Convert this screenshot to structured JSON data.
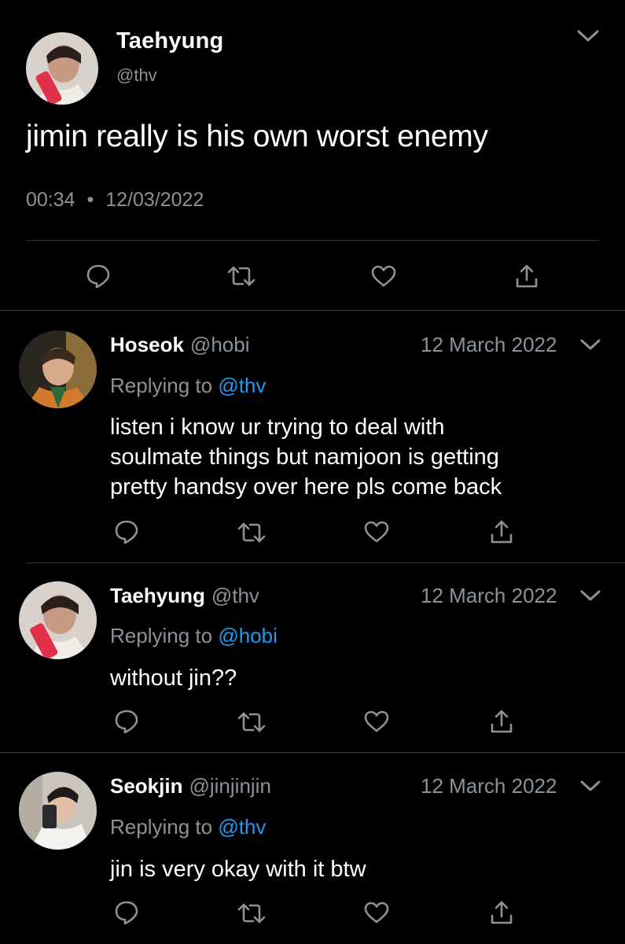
{
  "main_tweet": {
    "name": "Taehyung",
    "handle": "@thv",
    "text": "jimin really is his own worst enemy",
    "time": "00:34",
    "separator": "•",
    "date": "12/03/2022",
    "avatar_icon": "avatar-taehyung",
    "actions": [
      "reply-icon",
      "retweet-icon",
      "like-icon",
      "share-icon"
    ]
  },
  "replies": [
    {
      "name": "Hoseok",
      "handle": "@hobi",
      "date": "12 March 2022",
      "replying_prefix": "Replying to ",
      "replying_to": "@thv",
      "lines": [
        "listen i know ur trying to deal with",
        "soulmate things but namjoon is getting",
        "pretty handsy over here pls come back"
      ]
    },
    {
      "name": "Taehyung",
      "handle": "@thv",
      "date": "12 March 2022",
      "replying_prefix": "Replying to ",
      "replying_to": "@hobi",
      "lines": [
        "without jin??"
      ]
    },
    {
      "name": "Seokjin",
      "handle": "@jinjinjin",
      "date": "12 March 2022",
      "replying_prefix": "Replying to ",
      "replying_to": "@thv",
      "lines": [
        "jin is very okay with it btw"
      ]
    }
  ],
  "colors": {
    "background": "#000000",
    "text": "#ffffff",
    "secondary": "#8b9298",
    "link": "#1d9bf0",
    "divider": "#2f3336"
  }
}
